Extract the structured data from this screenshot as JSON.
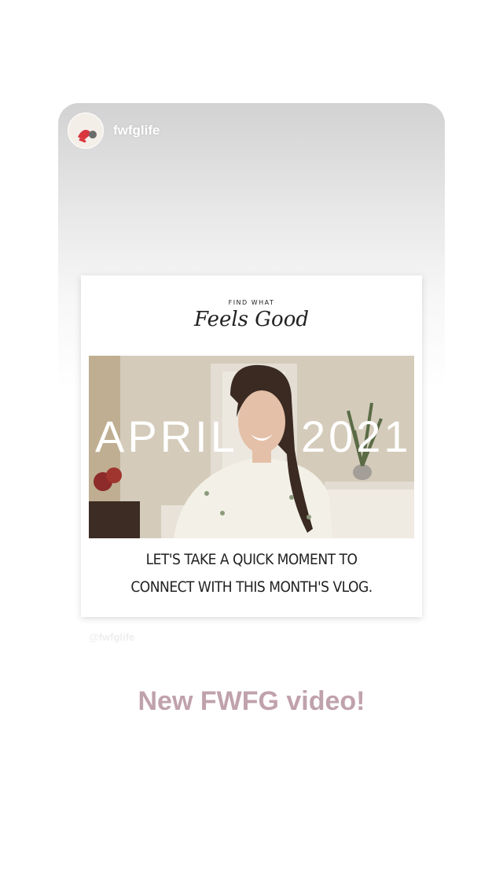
{
  "shared_post": {
    "username": "fwfglife"
  },
  "post": {
    "brand_small": "FIND WHAT",
    "brand_script": "Feels Good",
    "video_title_left": "APRIL",
    "video_title_right": "2021",
    "caption_line1": "LET'S TAKE A QUICK MOMENT TO",
    "caption_line2": "CONNECT WITH THIS MONTH'S VLOG."
  },
  "watermark": "@fwfglife",
  "story_text": "New FWFG video!",
  "colors": {
    "story_text": "#c0a2ac",
    "card_top": "#d2d2d2"
  }
}
